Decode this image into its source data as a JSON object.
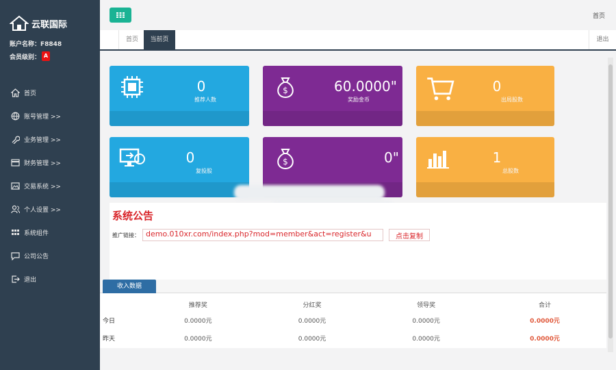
{
  "brand": {
    "name": "云联国际",
    "account_line": "账户名称：F8848",
    "level_label": "会员级别：",
    "level_badge": "A"
  },
  "sidebar": {
    "items": [
      {
        "label": "首页",
        "icon": "home-icon"
      },
      {
        "label": "账号管理 >>",
        "icon": "globe-icon"
      },
      {
        "label": "业务管理 >>",
        "icon": "wrench-icon"
      },
      {
        "label": "财务管理 >>",
        "icon": "card-icon"
      },
      {
        "label": "交易系统 >>",
        "icon": "image-icon"
      },
      {
        "label": "个人设置 >>",
        "icon": "users-icon"
      },
      {
        "label": "系统组件",
        "icon": "grid-icon"
      },
      {
        "label": "公司公告",
        "icon": "comment-icon"
      },
      {
        "label": "退出",
        "icon": "sign-out-icon"
      }
    ]
  },
  "topbar": {
    "home_link": "首页"
  },
  "tabs": {
    "home": "首页",
    "current": "当前页",
    "exit": "退出"
  },
  "cards": [
    {
      "value": "0",
      "label": "推荐人数",
      "icon": "chip-icon",
      "color": "#23a8e0"
    },
    {
      "value": "60.0000\"",
      "label": "奖励金币",
      "icon": "money-bag-icon",
      "color": "#7e2a93"
    },
    {
      "value": "0",
      "label": "出局股数",
      "icon": "cart-icon",
      "color": "#f9b043"
    },
    {
      "value": "0",
      "label": "复投股",
      "icon": "monitor-icon",
      "color": "#23a8e0"
    },
    {
      "value": "0\"",
      "label": "",
      "icon": "money-bag-icon",
      "color": "#7e2a93"
    },
    {
      "value": "1",
      "label": "总股数",
      "icon": "bar-chart-icon",
      "color": "#f9b043"
    }
  ],
  "notice": {
    "title": "系统公告",
    "promo_label": "推广链接：",
    "promo_url": "demo.010xr.com/index.php?mod=member&act=register&u",
    "copy_label": "点击复制"
  },
  "income": {
    "tab_label": "收入数据",
    "columns": [
      "推荐奖",
      "分红奖",
      "领导奖",
      "合计"
    ],
    "rows": [
      {
        "label": "今日",
        "values": [
          "0.0000元",
          "0.0000元",
          "0.0000元",
          "0.0000元"
        ]
      },
      {
        "label": "昨天",
        "values": [
          "0.0000元",
          "0.0000元",
          "0.0000元",
          "0.0000元"
        ]
      }
    ]
  }
}
